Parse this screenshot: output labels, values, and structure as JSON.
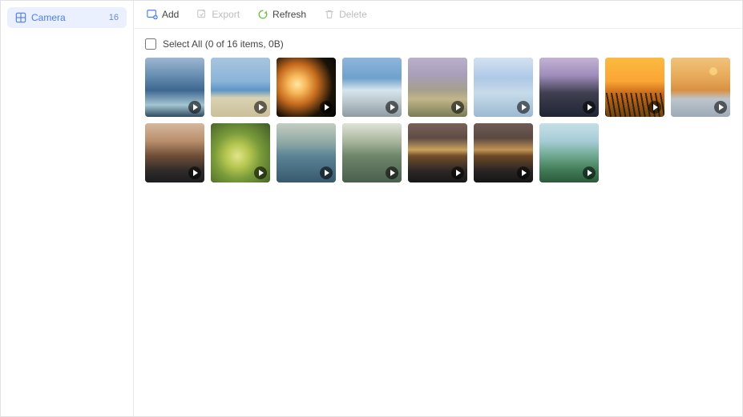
{
  "sidebar": {
    "items": [
      {
        "label": "Camera",
        "count": "16"
      }
    ]
  },
  "toolbar": {
    "add_label": "Add",
    "export_label": "Export",
    "refresh_label": "Refresh",
    "delete_label": "Delete"
  },
  "selection": {
    "select_all_label": "Select All (0 of 16 items, 0B)"
  },
  "colors": {
    "accent": "#4d7df0",
    "refresh": "#6fbf44",
    "disabled": "#bdbdbd"
  },
  "thumbnails": {
    "count": 16
  }
}
